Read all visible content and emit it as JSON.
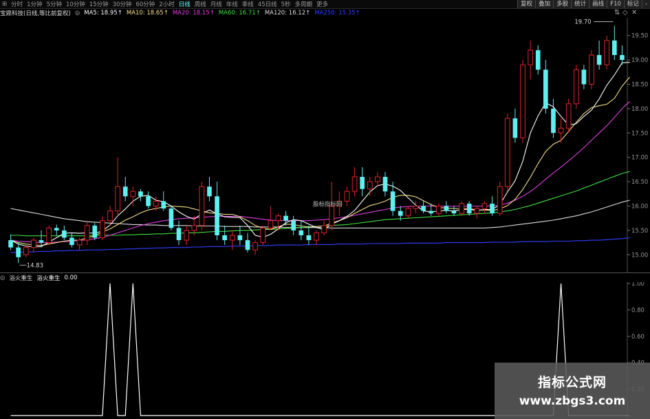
{
  "toolbar": {
    "timeframes": [
      "分时",
      "1分钟",
      "5分钟",
      "10分钟",
      "15分钟",
      "30分钟",
      "60分钟",
      "2小时",
      "日线",
      "周线",
      "月线",
      "年线",
      "季线",
      "45日线",
      "5秒",
      "多周期",
      "更多"
    ],
    "active_timeframe": "日线",
    "right_buttons": [
      "复权",
      "叠加",
      "多股",
      "统计",
      "画线",
      "F10",
      "标记",
      "-"
    ]
  },
  "main_header": {
    "stock_title": "宝鼎科技(日线,等比前复权)",
    "ma": [
      {
        "label": "MA5: 18.95",
        "color": "#ffffff"
      },
      {
        "label": "MA10: 18.65",
        "color": "#f5e08a"
      },
      {
        "label": "MA20: 18.15",
        "color": "#e040e0"
      },
      {
        "label": "MA60: 16.71",
        "color": "#40e040"
      },
      {
        "label": "MA120: 16.12",
        "color": "#dddddd"
      },
      {
        "label": "MA250: 15.35",
        "color": "#3040ff"
      }
    ]
  },
  "price_axis": [
    "19.50",
    "19.00",
    "18.50",
    "18.00",
    "17.50",
    "17.00",
    "16.50",
    "16.00",
    "15.50",
    "15.00"
  ],
  "annotations": {
    "high": "19.70",
    "low": "14.83",
    "center_text": "股标指标网"
  },
  "indicator": {
    "name": "浴火重生",
    "line_label": "浴火重生",
    "value": "0.00",
    "axis": [
      "1.00",
      "0.80",
      "0.60",
      "0.40",
      "0.20"
    ]
  },
  "watermark": {
    "title": "指标公式网",
    "url": "www.zbgs3.com"
  },
  "colors": {
    "up": "#e0242a",
    "down": "#5ef0f0",
    "ma5": "#ffffff",
    "ma10": "#f5e08a",
    "ma20": "#e040e0",
    "ma60": "#40e040",
    "ma120": "#dddddd",
    "ma250": "#3040ff"
  },
  "chart_data": {
    "type": "candlestick",
    "ohlc": [
      [
        15.3,
        15.42,
        15.1,
        15.15
      ],
      [
        15.15,
        15.25,
        14.83,
        14.95
      ],
      [
        15.0,
        15.2,
        14.95,
        15.15
      ],
      [
        15.15,
        15.35,
        15.05,
        15.3
      ],
      [
        15.3,
        15.5,
        15.15,
        15.25
      ],
      [
        15.25,
        15.6,
        15.2,
        15.55
      ],
      [
        15.55,
        15.62,
        15.4,
        15.5
      ],
      [
        15.5,
        15.6,
        15.3,
        15.35
      ],
      [
        15.35,
        15.45,
        15.15,
        15.2
      ],
      [
        15.2,
        15.35,
        15.1,
        15.3
      ],
      [
        15.3,
        15.7,
        15.2,
        15.6
      ],
      [
        15.6,
        15.65,
        15.3,
        15.35
      ],
      [
        15.35,
        15.8,
        15.3,
        15.7
      ],
      [
        15.7,
        16.0,
        15.6,
        15.9
      ],
      [
        15.9,
        17.0,
        15.8,
        16.4
      ],
      [
        16.4,
        16.6,
        16.1,
        16.2
      ],
      [
        16.2,
        16.4,
        16.0,
        16.3
      ],
      [
        16.3,
        16.35,
        16.1,
        16.2
      ],
      [
        16.2,
        16.3,
        15.95,
        16.0
      ],
      [
        16.0,
        16.2,
        15.9,
        16.1
      ],
      [
        16.1,
        16.3,
        15.9,
        15.95
      ],
      [
        15.95,
        16.0,
        15.5,
        15.55
      ],
      [
        15.55,
        15.7,
        15.2,
        15.3
      ],
      [
        15.3,
        15.6,
        15.2,
        15.5
      ],
      [
        15.5,
        15.8,
        15.4,
        15.6
      ],
      [
        15.6,
        16.5,
        15.5,
        16.4
      ],
      [
        16.4,
        16.6,
        16.1,
        16.2
      ],
      [
        16.2,
        16.5,
        15.3,
        15.4
      ],
      [
        15.4,
        15.6,
        15.2,
        15.3
      ],
      [
        15.3,
        15.5,
        15.1,
        15.4
      ],
      [
        15.4,
        15.6,
        15.2,
        15.3
      ],
      [
        15.3,
        15.45,
        15.05,
        15.1
      ],
      [
        15.1,
        15.3,
        15.0,
        15.25
      ],
      [
        15.25,
        15.6,
        15.2,
        15.55
      ],
      [
        15.55,
        16.0,
        15.5,
        15.7
      ],
      [
        15.7,
        15.85,
        15.5,
        15.8
      ],
      [
        15.8,
        15.9,
        15.6,
        15.7
      ],
      [
        15.7,
        15.8,
        15.4,
        15.5
      ],
      [
        15.5,
        15.7,
        15.3,
        15.4
      ],
      [
        15.4,
        15.6,
        15.2,
        15.3
      ],
      [
        15.3,
        15.5,
        15.2,
        15.45
      ],
      [
        15.45,
        15.7,
        15.4,
        15.6
      ],
      [
        15.6,
        16.5,
        15.5,
        16.0
      ],
      [
        16.0,
        16.3,
        15.8,
        16.1
      ],
      [
        16.1,
        16.4,
        16.0,
        16.3
      ],
      [
        16.3,
        16.8,
        16.2,
        16.6
      ],
      [
        16.6,
        16.8,
        16.2,
        16.35
      ],
      [
        16.35,
        16.6,
        16.2,
        16.5
      ],
      [
        16.5,
        16.7,
        16.4,
        16.6
      ],
      [
        16.6,
        16.7,
        16.2,
        16.3
      ],
      [
        16.3,
        16.5,
        15.8,
        15.9
      ],
      [
        15.9,
        16.0,
        15.7,
        15.8
      ],
      [
        15.8,
        16.0,
        15.75,
        15.95
      ],
      [
        15.95,
        16.1,
        15.85,
        16.0
      ],
      [
        16.0,
        16.1,
        15.85,
        15.9
      ],
      [
        15.9,
        16.05,
        15.8,
        15.85
      ],
      [
        15.85,
        16.05,
        15.8,
        16.0
      ],
      [
        16.0,
        16.1,
        15.85,
        15.9
      ],
      [
        15.9,
        16.0,
        15.8,
        15.85
      ],
      [
        15.85,
        16.1,
        15.8,
        16.05
      ],
      [
        16.05,
        16.1,
        15.8,
        15.85
      ],
      [
        15.85,
        16.0,
        15.75,
        15.95
      ],
      [
        15.95,
        16.1,
        15.85,
        16.05
      ],
      [
        16.05,
        16.2,
        15.8,
        15.85
      ],
      [
        15.85,
        16.5,
        15.8,
        16.4
      ],
      [
        16.4,
        17.9,
        16.3,
        17.8
      ],
      [
        17.8,
        18.0,
        17.3,
        17.4
      ],
      [
        17.4,
        19.0,
        17.3,
        18.9
      ],
      [
        18.9,
        19.4,
        18.6,
        19.2
      ],
      [
        19.2,
        19.3,
        18.7,
        18.8
      ],
      [
        18.8,
        19.0,
        17.9,
        18.0
      ],
      [
        18.0,
        18.2,
        17.4,
        17.5
      ],
      [
        17.5,
        17.8,
        17.3,
        17.6
      ],
      [
        17.6,
        18.2,
        17.5,
        18.1
      ],
      [
        18.1,
        18.9,
        18.0,
        18.8
      ],
      [
        18.8,
        18.9,
        18.4,
        18.5
      ],
      [
        18.5,
        19.2,
        18.4,
        19.1
      ],
      [
        19.1,
        19.4,
        18.8,
        18.9
      ],
      [
        18.9,
        19.5,
        18.8,
        19.4
      ],
      [
        19.4,
        19.7,
        19.0,
        19.1
      ],
      [
        19.1,
        19.3,
        18.9,
        19.0
      ]
    ],
    "ma": {
      "ma5": [
        15.3,
        15.22,
        15.18,
        15.16,
        15.17,
        15.26,
        15.35,
        15.44,
        15.45,
        15.44,
        15.45,
        15.44,
        15.49,
        15.61,
        15.8,
        15.94,
        16.1,
        16.2,
        16.22,
        16.12,
        16.09,
        16.0,
        15.88,
        15.79,
        15.73,
        15.84,
        15.92,
        15.84,
        15.78,
        15.77,
        15.76,
        15.6,
        15.4,
        15.36,
        15.42,
        15.53,
        15.66,
        15.72,
        15.7,
        15.63,
        15.56,
        15.52,
        15.63,
        15.7,
        15.79,
        15.91,
        16.1,
        16.29,
        16.42,
        16.45,
        16.41,
        16.32,
        16.17,
        16.02,
        15.9,
        15.88,
        15.9,
        15.91,
        15.9,
        15.93,
        15.93,
        15.91,
        15.93,
        15.93,
        16.03,
        16.29,
        16.52,
        16.92,
        17.5,
        17.85,
        18.12,
        18.04,
        17.84,
        17.66,
        17.69,
        17.84,
        17.97,
        18.2,
        18.48,
        18.69,
        18.94,
        18.95
      ],
      "ma10": [
        15.3,
        15.25,
        15.22,
        15.2,
        15.19,
        15.22,
        15.25,
        15.28,
        15.3,
        15.3,
        15.35,
        15.39,
        15.47,
        15.53,
        15.62,
        15.71,
        15.78,
        15.86,
        15.92,
        15.95,
        15.98,
        16.0,
        15.99,
        15.98,
        15.94,
        15.9,
        15.86,
        15.85,
        15.83,
        15.83,
        15.78,
        15.7,
        15.6,
        15.55,
        15.52,
        15.57,
        15.63,
        15.62,
        15.59,
        15.57,
        15.58,
        15.59,
        15.65,
        15.7,
        15.76,
        15.85,
        15.93,
        16.01,
        16.05,
        16.1,
        16.18,
        16.22,
        16.22,
        16.19,
        16.11,
        16.03,
        15.97,
        15.96,
        15.95,
        15.95,
        15.95,
        15.92,
        15.92,
        15.91,
        15.94,
        16.01,
        16.14,
        16.34,
        16.59,
        16.87,
        17.12,
        17.27,
        17.35,
        17.53,
        17.72,
        17.9,
        18.02,
        18.06,
        18.09,
        18.21,
        18.46,
        18.65
      ],
      "ma20": [
        15.3,
        15.28,
        15.27,
        15.26,
        15.25,
        15.25,
        15.26,
        15.27,
        15.28,
        15.29,
        15.31,
        15.33,
        15.36,
        15.4,
        15.45,
        15.5,
        15.55,
        15.6,
        15.64,
        15.67,
        15.7,
        15.72,
        15.74,
        15.75,
        15.76,
        15.77,
        15.78,
        15.79,
        15.79,
        15.79,
        15.79,
        15.77,
        15.75,
        15.73,
        15.71,
        15.7,
        15.7,
        15.7,
        15.7,
        15.7,
        15.71,
        15.72,
        15.74,
        15.76,
        15.78,
        15.81,
        15.84,
        15.87,
        15.9,
        15.93,
        15.96,
        15.98,
        15.99,
        16.0,
        16.0,
        16.0,
        16.0,
        16.0,
        16.0,
        16.0,
        16.0,
        16.0,
        16.0,
        16.0,
        16.02,
        16.06,
        16.12,
        16.2,
        16.3,
        16.42,
        16.55,
        16.68,
        16.8,
        16.93,
        17.06,
        17.2,
        17.35,
        17.5,
        17.65,
        17.82,
        18.0,
        18.15
      ],
      "ma60": [
        15.4,
        15.4,
        15.39,
        15.39,
        15.39,
        15.39,
        15.39,
        15.39,
        15.39,
        15.39,
        15.39,
        15.4,
        15.4,
        15.4,
        15.4,
        15.41,
        15.41,
        15.42,
        15.42,
        15.43,
        15.43,
        15.44,
        15.44,
        15.45,
        15.45,
        15.46,
        15.47,
        15.48,
        15.48,
        15.49,
        15.5,
        15.5,
        15.51,
        15.52,
        15.52,
        15.53,
        15.54,
        15.55,
        15.56,
        15.57,
        15.58,
        15.59,
        15.6,
        15.61,
        15.62,
        15.64,
        15.66,
        15.68,
        15.7,
        15.72,
        15.73,
        15.74,
        15.75,
        15.76,
        15.77,
        15.78,
        15.79,
        15.8,
        15.81,
        15.82,
        15.83,
        15.84,
        15.85,
        15.86,
        15.88,
        15.9,
        15.93,
        15.97,
        16.01,
        16.06,
        16.11,
        16.16,
        16.21,
        16.26,
        16.31,
        16.37,
        16.43,
        16.49,
        16.55,
        16.61,
        16.67,
        16.71
      ],
      "ma120": [
        15.95,
        15.92,
        15.89,
        15.86,
        15.83,
        15.8,
        15.77,
        15.74,
        15.72,
        15.7,
        15.68,
        15.67,
        15.66,
        15.65,
        15.64,
        15.63,
        15.62,
        15.62,
        15.61,
        15.61,
        15.6,
        15.6,
        15.6,
        15.6,
        15.59,
        15.59,
        15.59,
        15.59,
        15.58,
        15.58,
        15.58,
        15.58,
        15.57,
        15.57,
        15.57,
        15.57,
        15.56,
        15.56,
        15.56,
        15.56,
        15.56,
        15.56,
        15.55,
        15.55,
        15.55,
        15.55,
        15.55,
        15.55,
        15.55,
        15.55,
        15.55,
        15.55,
        15.55,
        15.55,
        15.55,
        15.55,
        15.55,
        15.55,
        15.55,
        15.55,
        15.55,
        15.55,
        15.55,
        15.56,
        15.57,
        15.59,
        15.61,
        15.63,
        15.65,
        15.67,
        15.69,
        15.71,
        15.74,
        15.77,
        15.8,
        15.84,
        15.88,
        15.93,
        15.98,
        16.03,
        16.08,
        16.12
      ],
      "ma250": [
        15.05,
        15.05,
        15.06,
        15.06,
        15.07,
        15.07,
        15.08,
        15.08,
        15.09,
        15.09,
        15.1,
        15.1,
        15.1,
        15.11,
        15.11,
        15.12,
        15.12,
        15.13,
        15.13,
        15.14,
        15.14,
        15.15,
        15.15,
        15.15,
        15.16,
        15.16,
        15.17,
        15.17,
        15.17,
        15.18,
        15.18,
        15.18,
        15.19,
        15.19,
        15.19,
        15.2,
        15.2,
        15.2,
        15.2,
        15.21,
        15.21,
        15.21,
        15.21,
        15.22,
        15.22,
        15.22,
        15.22,
        15.23,
        15.23,
        15.23,
        15.23,
        15.23,
        15.24,
        15.24,
        15.24,
        15.24,
        15.24,
        15.25,
        15.25,
        15.25,
        15.25,
        15.25,
        15.25,
        15.26,
        15.26,
        15.26,
        15.26,
        15.27,
        15.27,
        15.27,
        15.27,
        15.28,
        15.28,
        15.28,
        15.29,
        15.29,
        15.3,
        15.3,
        15.31,
        15.32,
        15.33,
        15.35
      ]
    },
    "ylim": [
      14.75,
      19.75
    ],
    "indicator_values": [
      0,
      0,
      0,
      0,
      0,
      0,
      0,
      0,
      0,
      0,
      0,
      0,
      0,
      1,
      0,
      0,
      1,
      0,
      0,
      0,
      0,
      0,
      0,
      0,
      0,
      0,
      0,
      0,
      0,
      0,
      0,
      0,
      0,
      0,
      0,
      0,
      0,
      0,
      0,
      0,
      0,
      0,
      0,
      0,
      0,
      0,
      0,
      0,
      0,
      0,
      0,
      0,
      0,
      0,
      0,
      0,
      0,
      0,
      0,
      0,
      0,
      0,
      0,
      0,
      0,
      0,
      0,
      0,
      0,
      0,
      0,
      0,
      1,
      0,
      0,
      0,
      0,
      0,
      0,
      0,
      0,
      0
    ],
    "indicator_ylim": [
      0,
      1
    ]
  }
}
